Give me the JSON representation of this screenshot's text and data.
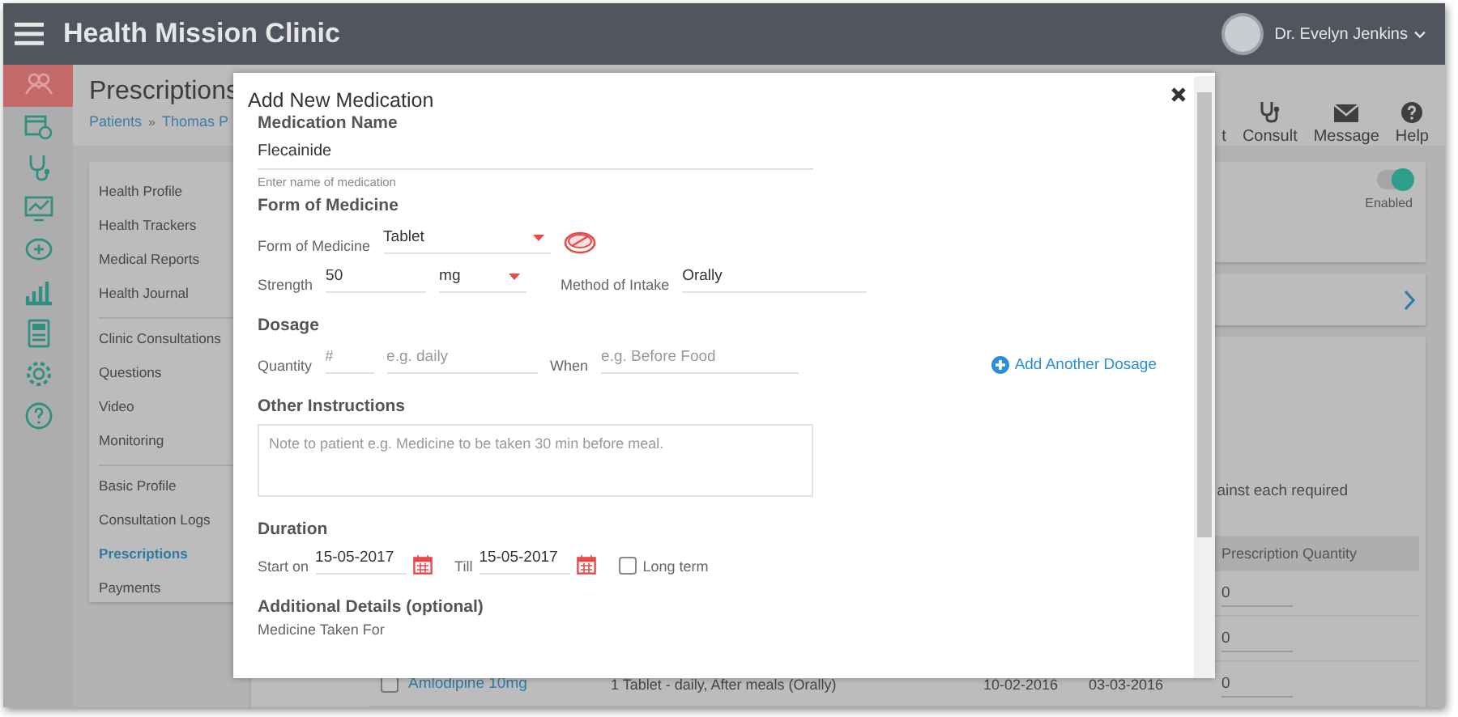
{
  "app": {
    "title": "Health Mission Clinic",
    "user": {
      "name": "Dr. Evelyn Jenkins"
    }
  },
  "rail": [
    {
      "selected": true
    },
    {
      "selected": false
    },
    {
      "selected": false
    },
    {
      "selected": false
    },
    {
      "selected": false
    },
    {
      "selected": false
    },
    {
      "selected": false
    },
    {
      "selected": false
    },
    {
      "selected": false
    }
  ],
  "page": {
    "title": "Prescriptions",
    "breadcrumb": [
      "Patients",
      "Thomas P"
    ],
    "breadcrumb_separator": "»"
  },
  "toolbar": [
    {
      "kind": "partial",
      "label": "t"
    },
    {
      "kind": "consult",
      "label": "Consult"
    },
    {
      "kind": "message",
      "label": "Message"
    },
    {
      "kind": "help",
      "label": "Help"
    }
  ],
  "sidebar": {
    "groups": [
      [
        {
          "label": "Health Profile",
          "selected": false
        },
        {
          "label": "Health Trackers",
          "selected": false
        },
        {
          "label": "Medical Reports",
          "selected": false
        },
        {
          "label": "Health Journal",
          "selected": false
        }
      ],
      [
        {
          "label": "Clinic Consultations",
          "selected": false
        },
        {
          "label": "Questions",
          "selected": false
        },
        {
          "label": "Video",
          "selected": false
        },
        {
          "label": "Monitoring",
          "selected": false
        }
      ],
      [
        {
          "label": "Basic Profile",
          "selected": false
        },
        {
          "label": "Consultation Logs",
          "selected": false
        },
        {
          "label": "Prescriptions",
          "selected": true
        },
        {
          "label": "Payments",
          "selected": false
        }
      ]
    ]
  },
  "status_panel": {
    "toggle": {
      "on": true,
      "label": "Enabled"
    }
  },
  "table": {
    "note": "ainst each required",
    "columns": [
      {
        "label": "Prescription Quantity"
      }
    ],
    "rows": [
      {
        "quantity": "0"
      },
      {
        "quantity": "0"
      },
      {
        "checked": false,
        "medicine": "Amlodipine 10mg",
        "dosage": "1 Tablet - daily, After meals (Orally)",
        "start": "10-02-2016",
        "end": "03-03-2016",
        "quantity": "0"
      }
    ]
  },
  "modal": {
    "title": "Add New Medication",
    "name_section": {
      "heading": "Medication Name",
      "value": "Flecainide",
      "hint": "Enter name of medication"
    },
    "form_section": {
      "heading": "Form of Medicine",
      "form": {
        "label": "Form of Medicine",
        "value": "Tablet"
      },
      "strength": {
        "label": "Strength",
        "value": "50",
        "unit": "mg"
      },
      "intake": {
        "label": "Method of Intake",
        "value": "Orally"
      }
    },
    "dosage_section": {
      "heading": "Dosage",
      "quantity": {
        "label": "Quantity",
        "placeholder": "#"
      },
      "frequency": {
        "placeholder": "e.g. daily"
      },
      "when": {
        "label": "When",
        "placeholder": "e.g. Before Food"
      },
      "add_link": "Add Another Dosage"
    },
    "instructions_section": {
      "heading": "Other Instructions",
      "placeholder": "Note to patient e.g. Medicine to be taken 30 min before meal."
    },
    "duration_section": {
      "heading": "Duration",
      "start": {
        "label": "Start on",
        "value": "15-05-2017"
      },
      "end": {
        "label": "Till",
        "value": "15-05-2017"
      },
      "long_term": {
        "label": "Long term",
        "checked": false
      }
    },
    "additional_section": {
      "heading": "Additional Details (optional)",
      "label": "Medicine Taken For"
    }
  }
}
